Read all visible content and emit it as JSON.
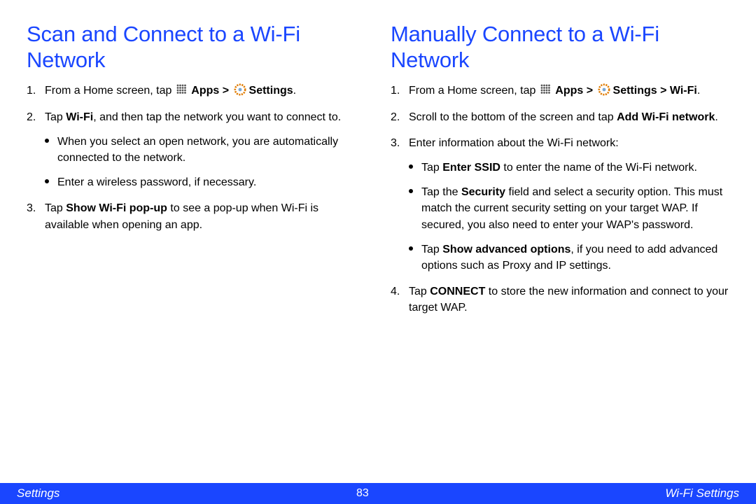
{
  "left": {
    "heading": "Scan and Connect to a Wi-Fi Network",
    "step1_a": "From a Home screen, tap ",
    "step1_apps": "Apps",
    "step1_gt": " > ",
    "step1_settings": "Settings",
    "step1_period": ".",
    "step2_a": "Tap ",
    "step2_wifi": "Wi-Fi",
    "step2_b": ", and then tap the network you want to connect to.",
    "step2_bullet1": "When you select an open network, you are automatically connected to the network.",
    "step2_bullet2": "Enter a wireless password, if necessary.",
    "step3_a": "Tap ",
    "step3_popup": "Show Wi-Fi pop-up",
    "step3_b": " to see a pop-up when Wi-Fi is available when opening an app."
  },
  "right": {
    "heading": "Manually Connect to a Wi‑Fi Network",
    "step1_a": "From a Home screen, tap ",
    "step1_apps": "Apps",
    "step1_gt": " > ",
    "step1_settings": "Settings",
    "step1_gt2": " > Wi-Fi",
    "step1_period": ".",
    "step2_a": "Scroll to the bottom of the screen and tap ",
    "step2_add": "Add Wi-Fi network",
    "step2_period": ".",
    "step3": "Enter information about the Wi-Fi network:",
    "step3_b1_a": "Tap ",
    "step3_b1_ssid": "Enter SSID",
    "step3_b1_b": " to enter the name of the Wi-Fi network.",
    "step3_b2_a": "Tap the ",
    "step3_b2_sec": "Security",
    "step3_b2_b": " field and select a security option. This must match the current security setting on your target WAP. If secured, you also need to enter your WAP's password.",
    "step3_b3_a": "Tap ",
    "step3_b3_adv": "Show advanced options",
    "step3_b3_b": ", if you need to add advanced options such as Proxy and IP settings.",
    "step4_a": "Tap ",
    "step4_connect": "CONNECT",
    "step4_b": " to store the new information and connect to your target WAP."
  },
  "footer": {
    "left": "Settings",
    "page": "83",
    "right": "Wi-Fi Settings"
  }
}
